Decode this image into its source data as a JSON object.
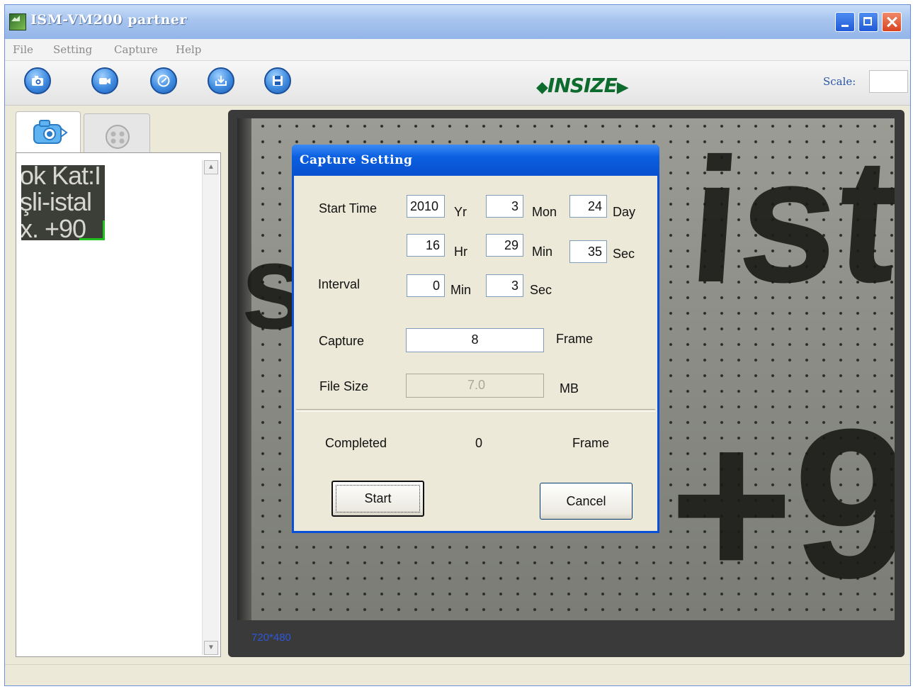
{
  "window": {
    "title": "ISM-VM200 partner",
    "icon": "app-picture-icon"
  },
  "menu": [
    "File",
    "Setting",
    "Capture",
    "Help"
  ],
  "toolbar": {
    "buttons": [
      "camera-icon",
      "video-camera-icon",
      "timer-icon",
      "save-to-disk-icon",
      "floppy-disk-icon"
    ],
    "brand": "INSIZE",
    "scale_label": "Scale:",
    "scale_value": ""
  },
  "tabs": [
    "photo-tab",
    "film-tab"
  ],
  "thumbnail_text": [
    "ok Kat:I",
    "şli-istal",
    "x. +90"
  ],
  "viewer": {
    "resolution": "720*480"
  },
  "dialog": {
    "title": "Capture Setting",
    "start_time_label": "Start Time",
    "year": "2010",
    "yr": "Yr",
    "month": "3",
    "mon": "Mon",
    "day": "24",
    "day_label": "Day",
    "hour": "16",
    "hr": "Hr",
    "minute": "29",
    "min": "Min",
    "second": "35",
    "sec": "Sec",
    "interval_label": "Interval",
    "interval_min": "0",
    "interval_min_label": "Min",
    "interval_sec": "3",
    "interval_sec_label": "Sec",
    "capture_label": "Capture",
    "capture_value": "8",
    "frame_label": "Frame",
    "file_size_label": "File Size",
    "file_size_value": "7.0",
    "mb_label": "MB",
    "completed_label": "Completed",
    "completed_value": "0",
    "completed_frame_label": "Frame",
    "start_button": "Start",
    "cancel_button": "Cancel"
  },
  "colors": {
    "title_bar": "#0a5fe0",
    "brand": "#0e6b2e",
    "selection": "#22c11f"
  }
}
